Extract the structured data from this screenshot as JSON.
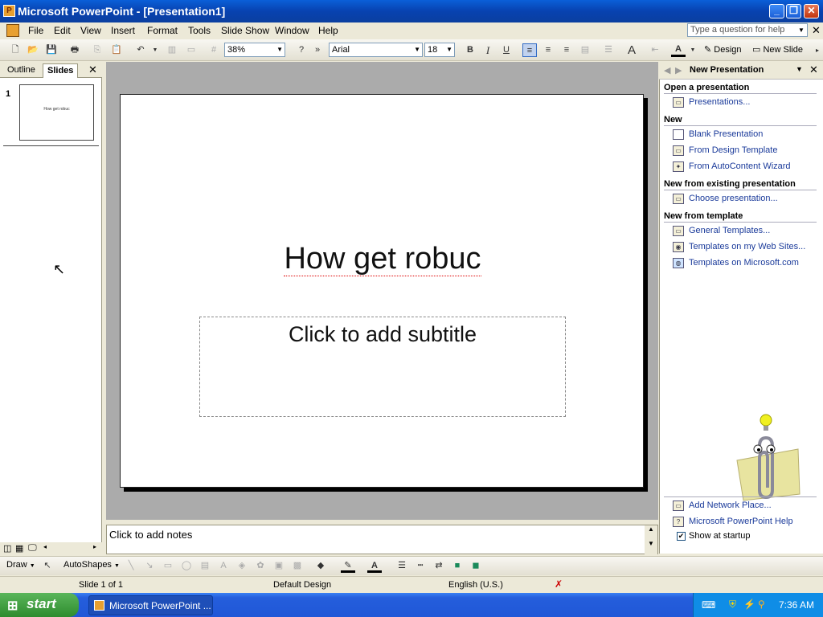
{
  "window": {
    "title": "Microsoft PowerPoint - [Presentation1]",
    "app_icon_glyph": "P"
  },
  "menu": {
    "items": [
      "File",
      "Edit",
      "View",
      "Insert",
      "Format",
      "Tools",
      "Slide Show",
      "Window",
      "Help"
    ],
    "help_placeholder": "Type a question for help"
  },
  "toolbar": {
    "zoom": "38%",
    "font": "Arial",
    "font_size": "18",
    "design_label": "Design",
    "new_slide_label": "New Slide"
  },
  "left_pane": {
    "tabs": [
      "Outline",
      "Slides"
    ],
    "slide_number": "1",
    "thumb_text": "How get robuc"
  },
  "slide": {
    "title": "How get robuc",
    "subtitle_placeholder": "Click to add subtitle"
  },
  "notes": {
    "placeholder": "Click to add notes"
  },
  "task_pane": {
    "title": "New Presentation",
    "sections": [
      {
        "heading": "Open a presentation",
        "links": [
          "Presentations..."
        ]
      },
      {
        "heading": "New",
        "links": [
          "Blank Presentation",
          "From Design Template",
          "From AutoContent Wizard"
        ]
      },
      {
        "heading": "New from existing presentation",
        "links": [
          "Choose presentation..."
        ]
      },
      {
        "heading": "New from template",
        "links": [
          "General Templates...",
          "Templates on my Web Sites...",
          "Templates on Microsoft.com"
        ]
      }
    ],
    "footer_links": [
      "Add Network Place...",
      "Microsoft PowerPoint Help"
    ],
    "show_at_startup": "Show at startup"
  },
  "drawbar": {
    "draw_label": "Draw",
    "autoshapes_label": "AutoShapes"
  },
  "status": {
    "slide_info": "Slide 1 of 1",
    "design": "Default Design",
    "language": "English (U.S.)"
  },
  "taskbar": {
    "start_label": "start",
    "app_label": "Microsoft PowerPoint ...",
    "time": "7:36 AM"
  }
}
